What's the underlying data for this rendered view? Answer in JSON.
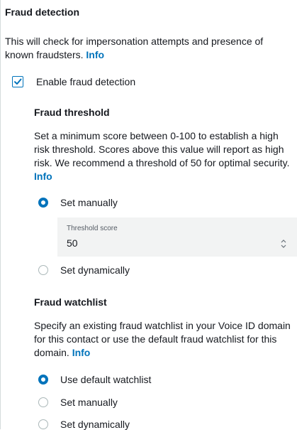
{
  "section": {
    "title": "Fraud detection",
    "description": "This will check for impersonation attempts and presence of known fraudsters.",
    "info_link": "Info",
    "enable_checkbox": {
      "label": "Enable fraud detection",
      "checked": true
    }
  },
  "threshold": {
    "title": "Fraud threshold",
    "description": "Set a minimum score between 0-100 to establish a high risk threshold. Scores above this value will report as high risk. We recommend a threshold of 50 for optimal security.",
    "info_link": "Info",
    "options": [
      {
        "label": "Set manually",
        "selected": true
      },
      {
        "label": "Set dynamically",
        "selected": false
      }
    ],
    "field": {
      "label": "Threshold score",
      "value": "50",
      "stepper_icon": "chevron-up-down-icon"
    }
  },
  "watchlist": {
    "title": "Fraud watchlist",
    "description": "Specify an existing fraud watchlist in your Voice ID domain for this contact or use the default fraud watchlist for this domain.",
    "info_link": "Info",
    "options": [
      {
        "label": "Use default watchlist",
        "selected": true
      },
      {
        "label": "Set manually",
        "selected": false
      },
      {
        "label": "Set dynamically",
        "selected": false
      }
    ]
  },
  "colors": {
    "accent": "#0073bb",
    "text": "#16191f",
    "field_background": "#f2f3f3",
    "radio_border": "#aab7b8"
  }
}
